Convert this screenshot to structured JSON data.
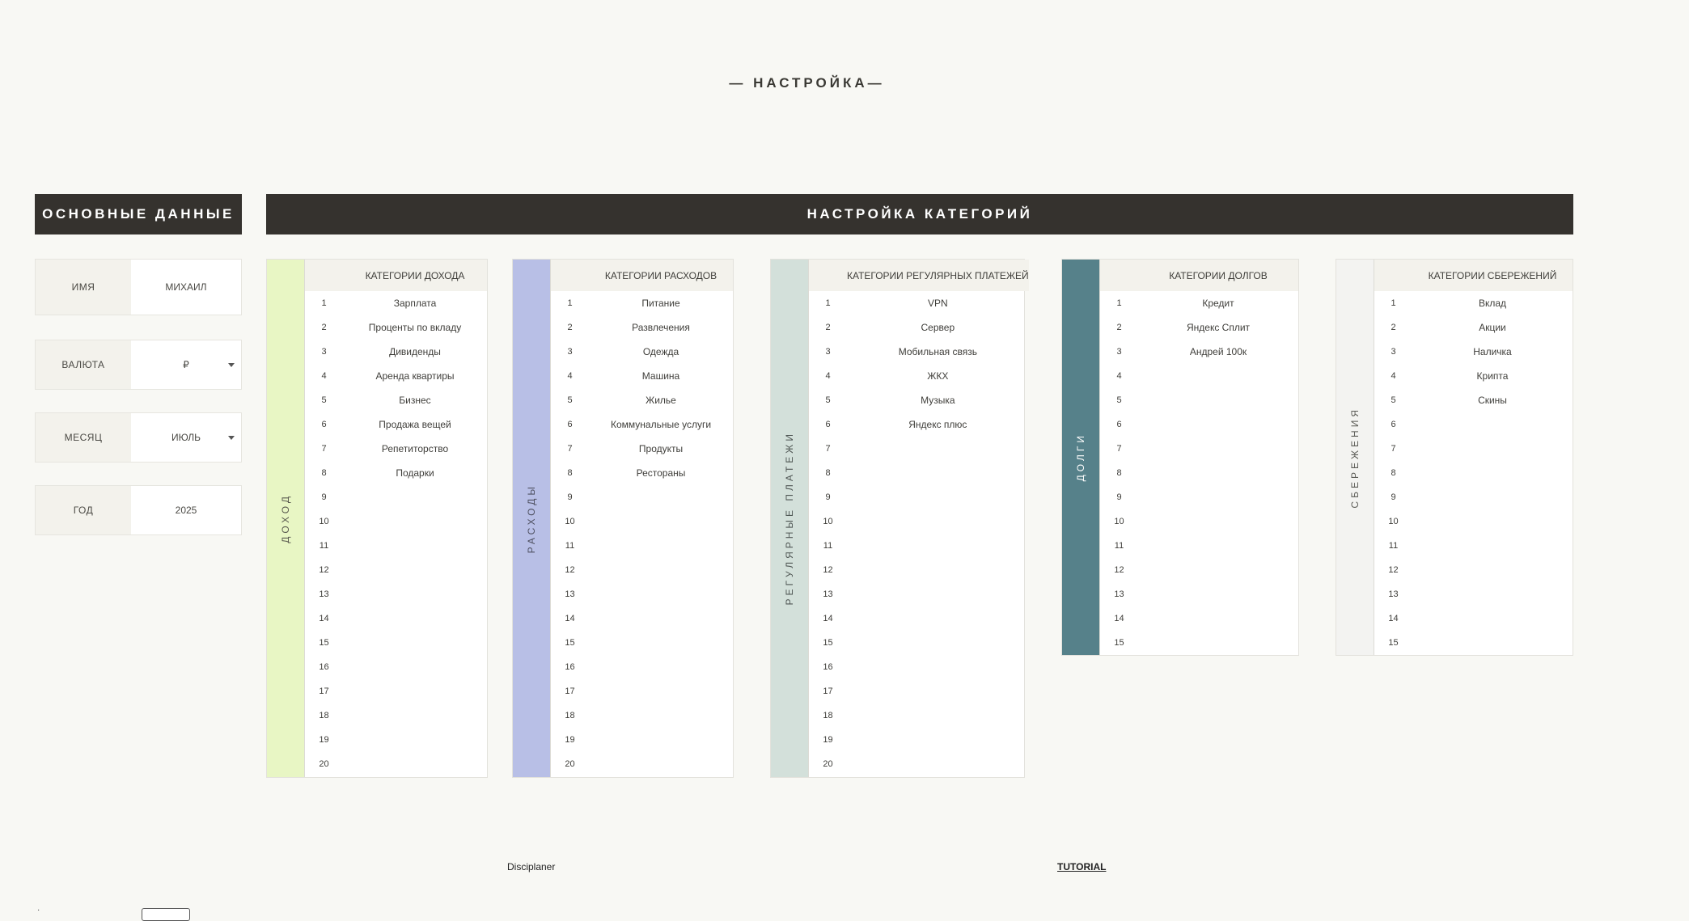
{
  "page_title": "— НАСТРОЙКА—",
  "basic": {
    "header": "ОСНОВНЫЕ ДАННЫЕ",
    "name_label": "ИМЯ",
    "name_value": "МИХАИЛ",
    "currency_label": "ВАЛЮТА",
    "currency_value": "₽",
    "month_label": "МЕСЯЦ",
    "month_value": "ИЮЛЬ",
    "year_label": "ГОД",
    "year_value": "2025"
  },
  "categories_header": "НАСТРОЙКА КАТЕГОРИЙ",
  "panels": [
    {
      "side_label": "ДОХОД",
      "side_color": "#e8f6c4",
      "side_text_color": "#5a5a50",
      "header": "КАТЕГОРИИ ДОХОДА",
      "count": 20,
      "items": [
        "Зарплата",
        "Проценты по вкладу",
        "Дивиденды",
        "Аренда квартиры",
        "Бизнес",
        "Продажа вещей",
        "Репетиторство",
        "Подарки"
      ]
    },
    {
      "side_label": "РАСХОДЫ",
      "side_color": "#b8bfe6",
      "side_text_color": "#4e5060",
      "header": "КАТЕГОРИИ РАСХОДОВ",
      "count": 20,
      "items": [
        "Питание",
        "Развлечения",
        "Одежда",
        "Машина",
        "Жилье",
        "Коммунальные услуги",
        "Продукты",
        "Рестораны"
      ]
    },
    {
      "side_label": "РЕГУЛЯРНЫЕ ПЛАТЕЖИ",
      "side_color": "#d3e0da",
      "side_text_color": "#4f5654",
      "header": "КАТЕГОРИИ РЕГУЛЯРНЫХ ПЛАТЕЖЕЙ",
      "count": 20,
      "items": [
        "VPN",
        "Сервер",
        "Мобильная связь",
        "ЖКХ",
        "Музыка",
        "Яндекс плюс"
      ]
    },
    {
      "side_label": "ДОЛГИ",
      "side_color": "#56818a",
      "side_text_color": "#ffffff",
      "header": "КАТЕГОРИИ ДОЛГОВ",
      "count": 15,
      "items": [
        "Кредит",
        "Яндекс Сплит",
        "Андрей 100к"
      ]
    },
    {
      "side_label": "СБЕРЕЖЕНИЯ",
      "side_color": "#f3f3f1",
      "side_text_color": "#5a5a55",
      "header": "КАТЕГОРИИ СБЕРЕЖЕНИЙ",
      "count": 15,
      "items": [
        "Вклад",
        "Акции",
        "Наличка",
        "Крипта",
        "Скины"
      ]
    }
  ],
  "footer": {
    "brand": "Disciplaner",
    "tutorial": "TUTORIAL"
  }
}
